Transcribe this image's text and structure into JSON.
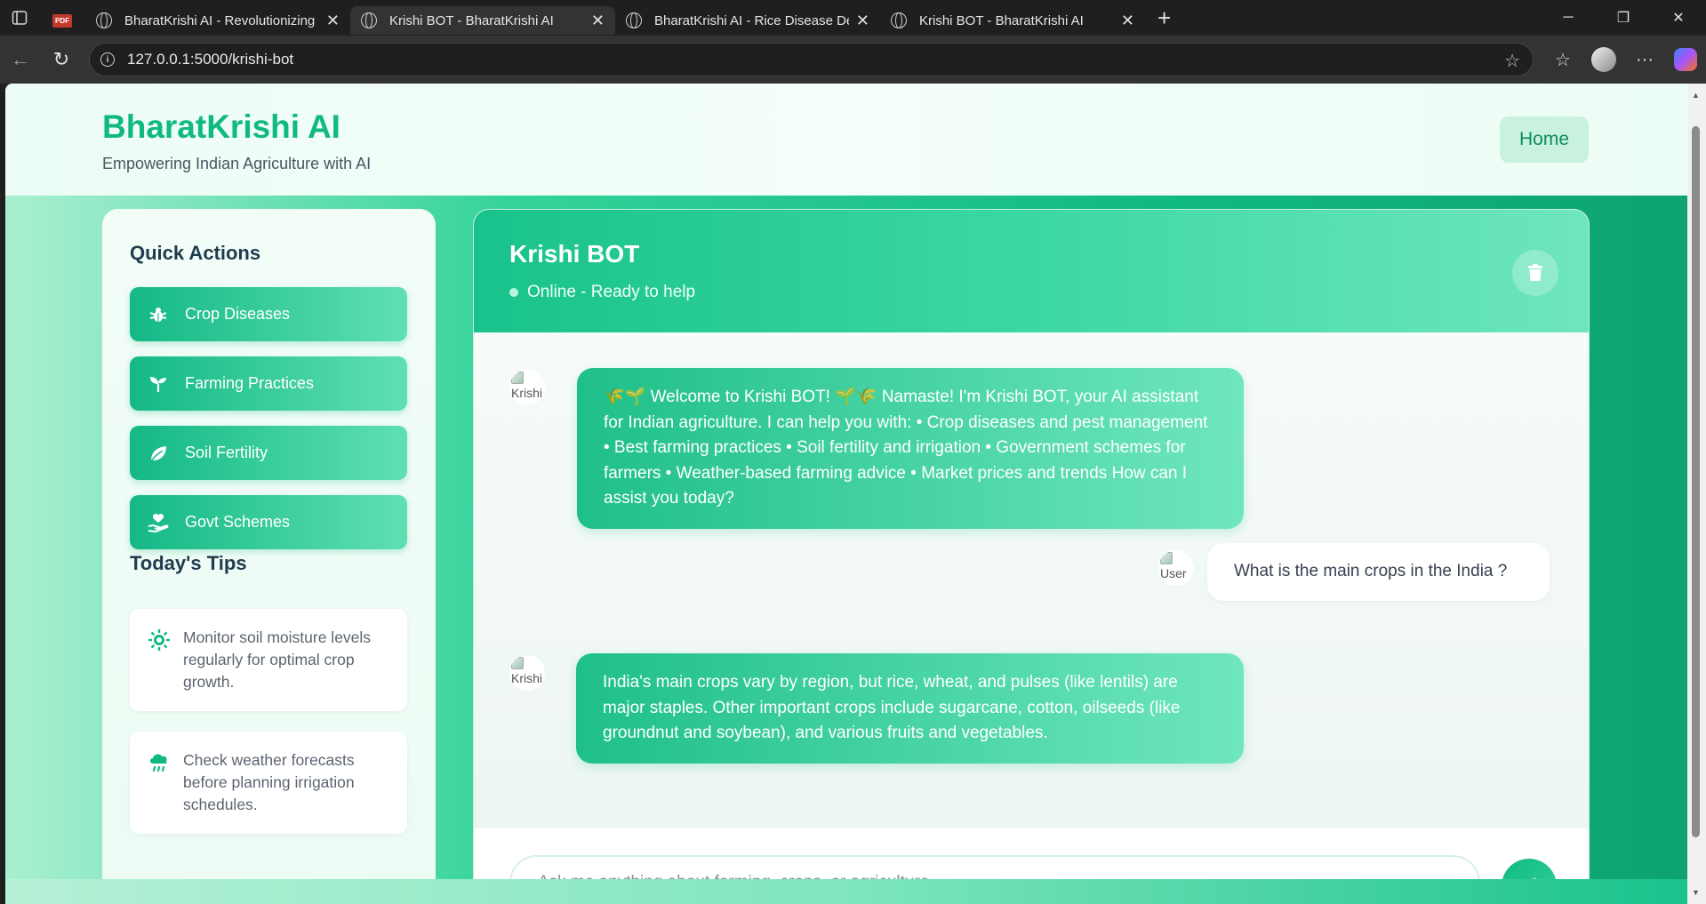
{
  "browser": {
    "tabs": [
      {
        "title": "BharatKrishi AI - Revolutionizing I",
        "active": false
      },
      {
        "title": "Krishi BOT - BharatKrishi AI",
        "active": true
      },
      {
        "title": "BharatKrishi AI - Rice Disease Det",
        "active": false
      },
      {
        "title": "Krishi BOT - BharatKrishi AI",
        "active": false
      }
    ],
    "pdf_label": "PDF",
    "url": "127.0.0.1:5000/krishi-bot"
  },
  "header": {
    "brand": "BharatKrishi AI",
    "tagline": "Empowering Indian Agriculture with AI",
    "home_label": "Home"
  },
  "sidebar": {
    "quick_actions_title": "Quick Actions",
    "quick_actions": [
      {
        "label": "Crop Diseases",
        "icon": "bug-icon"
      },
      {
        "label": "Farming Practices",
        "icon": "seedling-icon"
      },
      {
        "label": "Soil Fertility",
        "icon": "leaf-icon"
      },
      {
        "label": "Govt Schemes",
        "icon": "hand-holding-heart-icon"
      }
    ],
    "tips_title": "Today's Tips",
    "tips": [
      {
        "text": "Monitor soil moisture levels regularly for optimal crop growth.",
        "icon": "sun-icon"
      },
      {
        "text": "Check weather forecasts before planning irrigation schedules.",
        "icon": "cloud-rain-icon"
      }
    ]
  },
  "chat": {
    "title": "Krishi BOT",
    "status": "Online - Ready to help",
    "bot_avatar_alt": "Krishi",
    "user_avatar_alt": "User",
    "messages": [
      {
        "sender": "bot",
        "text": "🌾🌱 Welcome to Krishi BOT! 🌱🌾 Namaste! I'm Krishi BOT, your AI assistant for Indian agriculture. I can help you with: • Crop diseases and pest management • Best farming practices • Soil fertility and irrigation • Government schemes for farmers • Weather-based farming advice • Market prices and trends How can I assist you today?"
      },
      {
        "sender": "user",
        "text": "What is the main crops in the India ?"
      },
      {
        "sender": "bot",
        "text": "India's main crops vary by region, but rice, wheat, and pulses (like lentils) are major staples. Other important crops include sugarcane, cotton, oilseeds (like groundnut and soybean), and various fruits and vegetables."
      }
    ],
    "input_placeholder": "Ask me anything about farming, crops, or agriculture..."
  },
  "colors": {
    "accent": "#10b981",
    "accent_light": "#6fe6bd",
    "text_dark": "#1f3b4d"
  }
}
